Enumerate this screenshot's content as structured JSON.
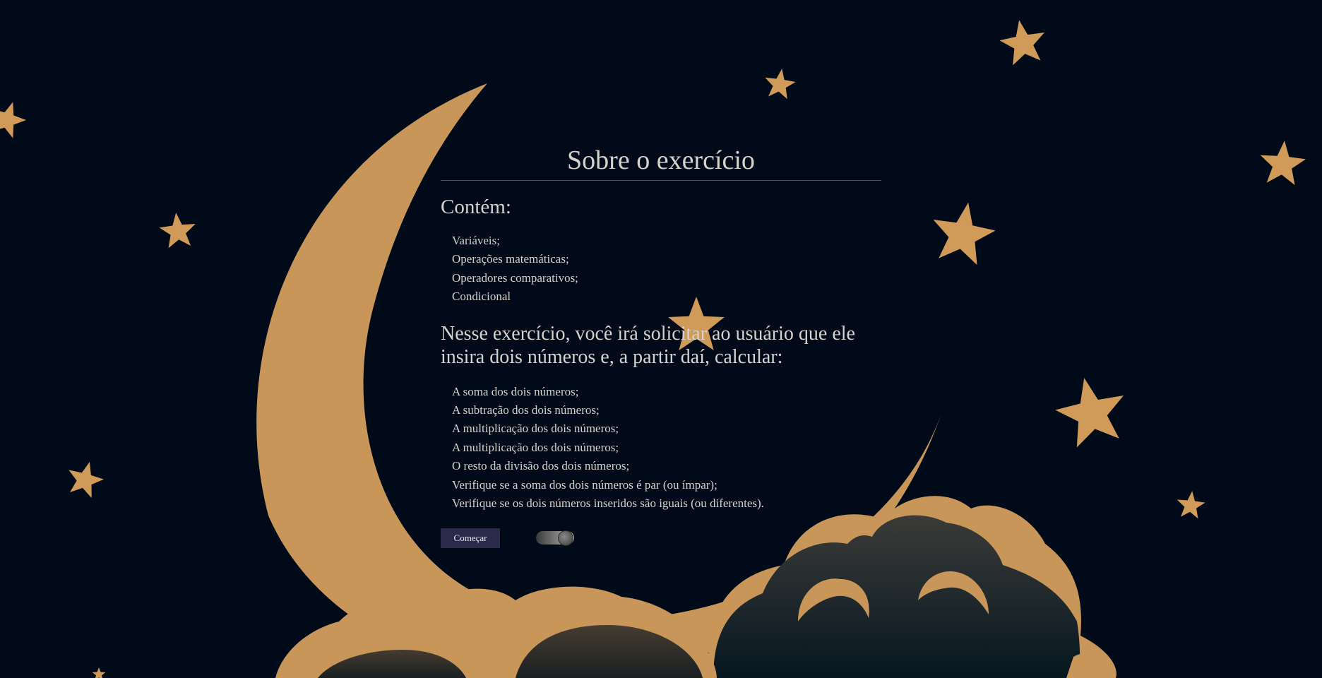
{
  "colors": {
    "background": "#010a18",
    "moon": "#c89658",
    "star": "#d09a58",
    "text": "#d6d3ce",
    "button": "#2b2a4a"
  },
  "page": {
    "title": "Sobre o exercício",
    "contains_heading": "Contém:",
    "topics": [
      "Variáveis;",
      "Operações matemáticas;",
      "Operadores comparativos;",
      "Condicional"
    ],
    "task_heading": "Nesse exercício, você irá solicitar ao usuário que ele insira dois números e, a partir daí, calcular:",
    "tasks": [
      "A soma dos dois números;",
      "A subtração dos dois números;",
      "A multiplicação dos dois números;",
      "A multiplicação dos dois números;",
      "O resto da divisão dos dois números;",
      "Verifique se a soma dos dois números é par (ou ímpar);",
      "Verifique se os dois números inseridos são iguais (ou diferentes)."
    ]
  },
  "controls": {
    "start_label": "Começar",
    "toggle_icon": "theme-toggle-switch"
  },
  "decorations": {
    "icons": [
      "moon-icon",
      "star-icon",
      "cloud-icon"
    ]
  }
}
